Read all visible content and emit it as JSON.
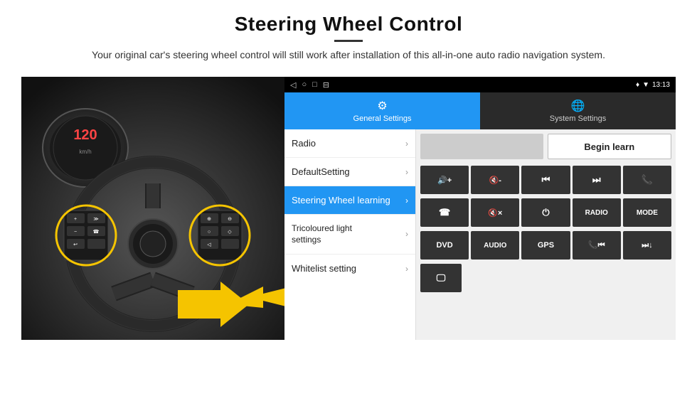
{
  "header": {
    "title": "Steering Wheel Control",
    "subtitle": "Your original car's steering wheel control will still work after installation of this all-in-one auto radio navigation system."
  },
  "status_bar": {
    "nav_icons": [
      "◁",
      "○",
      "□",
      "⊟"
    ],
    "time": "13:13",
    "right_icons": [
      "♦",
      "▼"
    ]
  },
  "tabs": [
    {
      "id": "general",
      "label": "General Settings",
      "icon": "⚙",
      "active": true
    },
    {
      "id": "system",
      "label": "System Settings",
      "icon": "🌐",
      "active": false
    }
  ],
  "menu_items": [
    {
      "id": "radio",
      "label": "Radio",
      "active": false
    },
    {
      "id": "default",
      "label": "DefaultSetting",
      "active": false
    },
    {
      "id": "steering",
      "label": "Steering Wheel learning",
      "active": true
    },
    {
      "id": "tricoloured",
      "label": "Tricoloured light settings",
      "active": false
    },
    {
      "id": "whitelist",
      "label": "Whitelist setting",
      "active": false
    }
  ],
  "begin_learn_label": "Begin learn",
  "control_buttons": {
    "row1": [
      {
        "id": "vol-up",
        "label": "🔊+"
      },
      {
        "id": "vol-down",
        "label": "🔇-"
      },
      {
        "id": "prev",
        "label": "⏮"
      },
      {
        "id": "next",
        "label": "⏭"
      },
      {
        "id": "phone",
        "label": "📞"
      }
    ],
    "row2": [
      {
        "id": "call",
        "label": "📞"
      },
      {
        "id": "mute",
        "label": "🔇×"
      },
      {
        "id": "power",
        "label": "⏻"
      },
      {
        "id": "radio-btn",
        "label": "RADIO"
      },
      {
        "id": "mode",
        "label": "MODE"
      }
    ],
    "row3": [
      {
        "id": "dvd",
        "label": "DVD"
      },
      {
        "id": "audio",
        "label": "AUDIO"
      },
      {
        "id": "gps",
        "label": "GPS"
      },
      {
        "id": "phone2",
        "label": "📞⏮"
      },
      {
        "id": "next2",
        "label": "⏭⏬"
      }
    ],
    "row4": [
      {
        "id": "screen-btn",
        "label": "🖵"
      }
    ]
  }
}
